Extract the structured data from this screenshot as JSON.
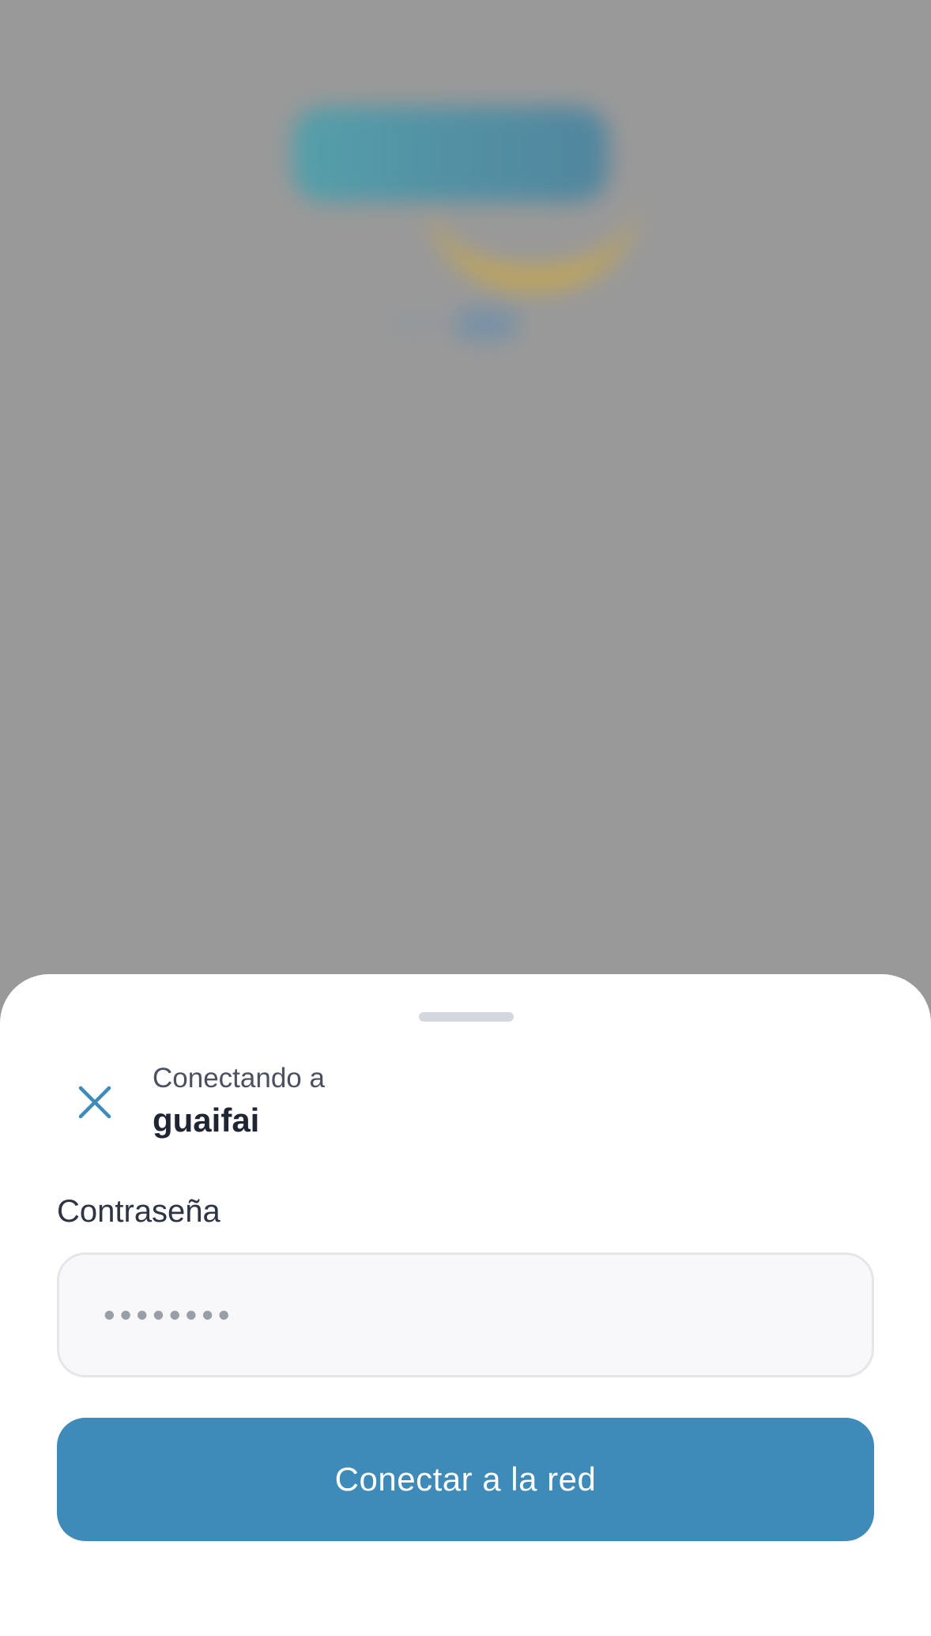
{
  "sheet": {
    "subtitle": "Conectando a",
    "network_name": "guaifai",
    "password_label": "Contraseña",
    "password_placeholder": "••••••••",
    "connect_label": "Conectar a la red"
  },
  "icons": {
    "close": "close-icon"
  },
  "colors": {
    "accent": "#3e8bba",
    "overlay": "#999999",
    "input_bg": "#f8f8fa"
  }
}
